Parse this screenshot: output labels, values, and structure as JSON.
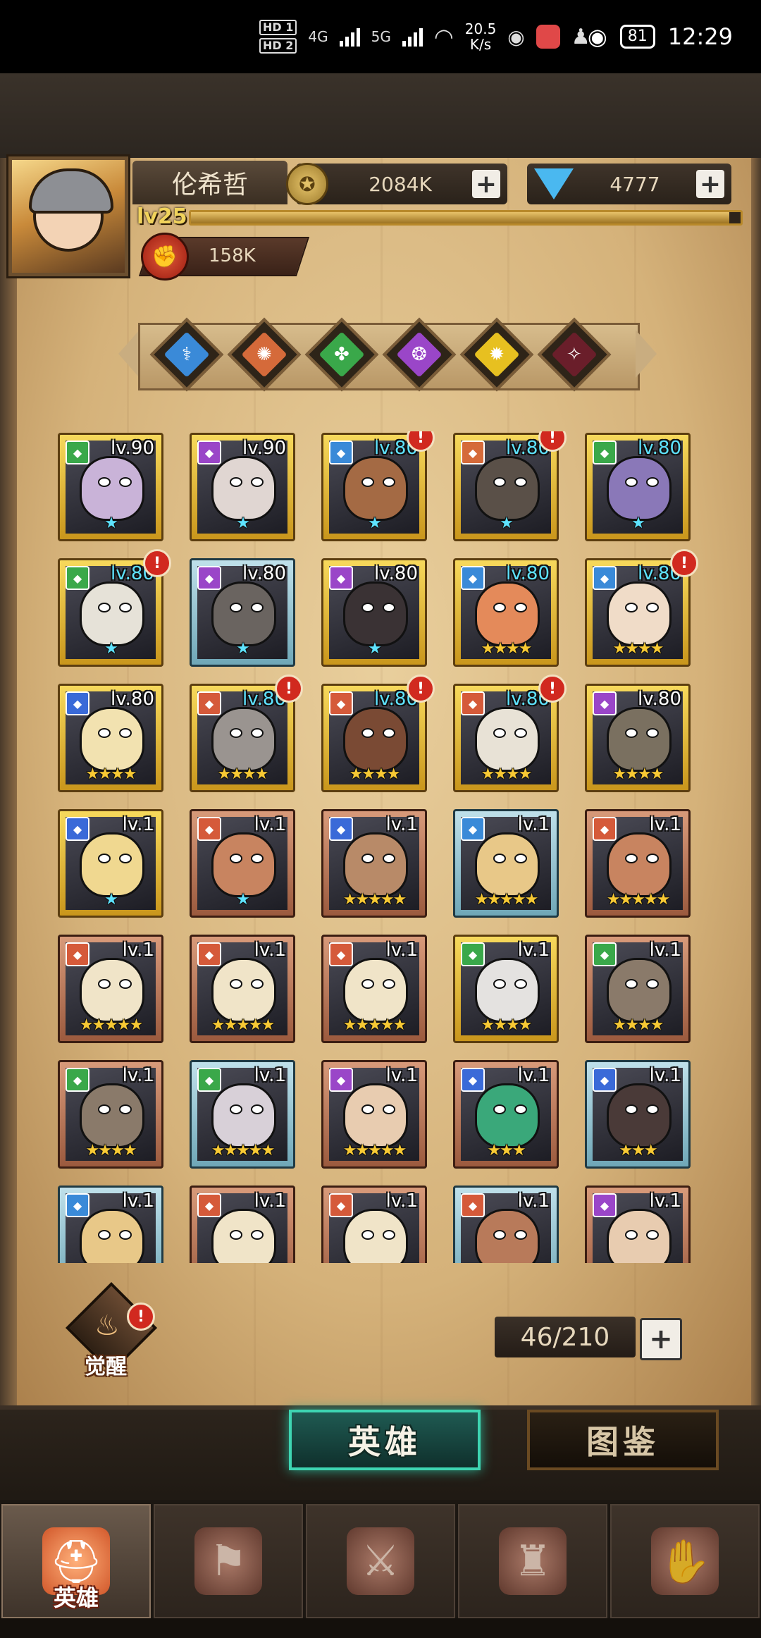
{
  "status_bar": {
    "hd1": "HD 1",
    "hd2": "HD 2",
    "net1": "4G",
    "net2": "5G",
    "speed_value": "20.5",
    "speed_unit": "K/s",
    "battery": "81",
    "time": "12:29",
    "icons": [
      "wechat-icon",
      "huawei-app-icon",
      "qq-icon",
      "eye-icon"
    ]
  },
  "player": {
    "name": "伦希哲",
    "level": "lv25",
    "gold": "2084K",
    "diamonds": "4777",
    "power": "158K",
    "xp_fraction": 0.98
  },
  "faction_filters": [
    {
      "name": "holy",
      "color": "#3a8ad8",
      "glyph": "⚕"
    },
    {
      "name": "fire",
      "color": "#d56a3a",
      "glyph": "✺"
    },
    {
      "name": "nature",
      "color": "#3aa84a",
      "glyph": "✤"
    },
    {
      "name": "arcane",
      "color": "#9a46c8",
      "glyph": "❂"
    },
    {
      "name": "light",
      "color": "#e7c020",
      "glyph": "✹"
    },
    {
      "name": "dark",
      "color": "#6a1e2a",
      "glyph": "✧"
    }
  ],
  "heroes": [
    {
      "frame": "gold",
      "tag": "#3aa84a",
      "level": "lv.90",
      "lvcolor": "white",
      "stars": "★",
      "starcolor": "blue",
      "alert": false,
      "skin": "#c9b3d8"
    },
    {
      "frame": "gold",
      "tag": "#9a46c8",
      "level": "lv.90",
      "lvcolor": "white",
      "stars": "★",
      "starcolor": "blue",
      "alert": false,
      "skin": "#e0d6d2"
    },
    {
      "frame": "gold",
      "tag": "#3a8ad8",
      "level": "lv.80",
      "lvcolor": "cyan",
      "stars": "★",
      "starcolor": "blue",
      "alert": true,
      "skin": "#a46a44"
    },
    {
      "frame": "gold",
      "tag": "#d56a3a",
      "level": "lv.80",
      "lvcolor": "cyan",
      "stars": "★",
      "starcolor": "blue",
      "alert": true,
      "skin": "#5a5048"
    },
    {
      "frame": "gold",
      "tag": "#3aa84a",
      "level": "lv.80",
      "lvcolor": "cyan",
      "stars": "★",
      "starcolor": "blue",
      "alert": false,
      "skin": "#8a78b8"
    },
    {
      "frame": "gold",
      "tag": "#3aa84a",
      "level": "lv.80",
      "lvcolor": "cyan",
      "stars": "★",
      "starcolor": "blue",
      "alert": true,
      "skin": "#e6e2d8"
    },
    {
      "frame": "silver",
      "tag": "#9a46c8",
      "level": "lv.80",
      "lvcolor": "white",
      "stars": "★",
      "starcolor": "blue",
      "alert": false,
      "skin": "#6a6460"
    },
    {
      "frame": "gold",
      "tag": "#9a46c8",
      "level": "lv.80",
      "lvcolor": "white",
      "stars": "★",
      "starcolor": "blue",
      "alert": false,
      "skin": "#3a3234"
    },
    {
      "frame": "gold",
      "tag": "#3a8ad8",
      "level": "lv.80",
      "lvcolor": "cyan",
      "stars": "★★★★",
      "starcolor": "gold",
      "alert": false,
      "skin": "#e48a5a"
    },
    {
      "frame": "gold",
      "tag": "#3a8ad8",
      "level": "lv.80",
      "lvcolor": "cyan",
      "stars": "★★★★",
      "starcolor": "gold",
      "alert": true,
      "skin": "#f0dcc8"
    },
    {
      "frame": "gold",
      "tag": "#3a6ad8",
      "level": "lv.80",
      "lvcolor": "white",
      "stars": "★★★★",
      "starcolor": "gold",
      "alert": false,
      "skin": "#f2e2b0"
    },
    {
      "frame": "gold",
      "tag": "#d55a3a",
      "level": "lv.80",
      "lvcolor": "cyan",
      "stars": "★★★★",
      "starcolor": "gold",
      "alert": true,
      "skin": "#9a9490"
    },
    {
      "frame": "gold",
      "tag": "#d55a3a",
      "level": "lv.80",
      "lvcolor": "cyan",
      "stars": "★★★★",
      "starcolor": "gold",
      "alert": true,
      "skin": "#7a4a34"
    },
    {
      "frame": "gold",
      "tag": "#d55a3a",
      "level": "lv.80",
      "lvcolor": "cyan",
      "stars": "★★★★",
      "starcolor": "gold",
      "alert": true,
      "skin": "#e8e2d6"
    },
    {
      "frame": "gold",
      "tag": "#9a46c8",
      "level": "lv.80",
      "lvcolor": "white",
      "stars": "★★★★",
      "starcolor": "gold",
      "alert": false,
      "skin": "#7a7060"
    },
    {
      "frame": "gold",
      "tag": "#3a6ad8",
      "level": "lv.1",
      "lvcolor": "white",
      "stars": "★",
      "starcolor": "blue",
      "alert": false,
      "skin": "#f0d890"
    },
    {
      "frame": "bronze",
      "tag": "#d55a3a",
      "level": "lv.1",
      "lvcolor": "white",
      "stars": "★",
      "starcolor": "blue",
      "alert": false,
      "skin": "#c88460"
    },
    {
      "frame": "bronze",
      "tag": "#3a6ad8",
      "level": "lv.1",
      "lvcolor": "white",
      "stars": "★★★★★",
      "starcolor": "gold",
      "alert": false,
      "skin": "#b88a68"
    },
    {
      "frame": "silver",
      "tag": "#3a8ad8",
      "level": "lv.1",
      "lvcolor": "white",
      "stars": "★★★★★",
      "starcolor": "gold",
      "alert": false,
      "skin": "#e8c888"
    },
    {
      "frame": "bronze",
      "tag": "#d55a3a",
      "level": "lv.1",
      "lvcolor": "white",
      "stars": "★★★★★",
      "starcolor": "gold",
      "alert": false,
      "skin": "#c88460"
    },
    {
      "frame": "bronze",
      "tag": "#d55a3a",
      "level": "lv.1",
      "lvcolor": "white",
      "stars": "★★★★★",
      "starcolor": "gold",
      "alert": false,
      "skin": "#f0e4c8"
    },
    {
      "frame": "bronze",
      "tag": "#d55a3a",
      "level": "lv.1",
      "lvcolor": "white",
      "stars": "★★★★★",
      "starcolor": "gold",
      "alert": false,
      "skin": "#f0e4c8"
    },
    {
      "frame": "bronze",
      "tag": "#d55a3a",
      "level": "lv.1",
      "lvcolor": "white",
      "stars": "★★★★★",
      "starcolor": "gold",
      "alert": false,
      "skin": "#f0e4c8"
    },
    {
      "frame": "gold",
      "tag": "#3aa84a",
      "level": "lv.1",
      "lvcolor": "white",
      "stars": "★★★★",
      "starcolor": "gold",
      "alert": false,
      "skin": "#e4e2e0"
    },
    {
      "frame": "bronze",
      "tag": "#3aa84a",
      "level": "lv.1",
      "lvcolor": "white",
      "stars": "★★★★",
      "starcolor": "gold",
      "alert": false,
      "skin": "#8a7a6a"
    },
    {
      "frame": "bronze",
      "tag": "#3aa84a",
      "level": "lv.1",
      "lvcolor": "white",
      "stars": "★★★★",
      "starcolor": "gold",
      "alert": false,
      "skin": "#8a7a6a"
    },
    {
      "frame": "silver",
      "tag": "#3aa84a",
      "level": "lv.1",
      "lvcolor": "white",
      "stars": "★★★★★",
      "starcolor": "gold",
      "alert": false,
      "skin": "#d8d0d8"
    },
    {
      "frame": "bronze",
      "tag": "#9a46c8",
      "level": "lv.1",
      "lvcolor": "white",
      "stars": "★★★★★",
      "starcolor": "gold",
      "alert": false,
      "skin": "#e8ccb0"
    },
    {
      "frame": "bronze",
      "tag": "#3a6ad8",
      "level": "lv.1",
      "lvcolor": "white",
      "stars": "★★★",
      "starcolor": "gold",
      "alert": false,
      "skin": "#3aa87a"
    },
    {
      "frame": "silver",
      "tag": "#3a6ad8",
      "level": "lv.1",
      "lvcolor": "white",
      "stars": "★★★",
      "starcolor": "gold",
      "alert": false,
      "skin": "#4a3a38"
    },
    {
      "frame": "silver",
      "tag": "#3a8ad8",
      "level": "lv.1",
      "lvcolor": "white",
      "stars": "",
      "starcolor": "gold",
      "alert": false,
      "skin": "#e8c888"
    },
    {
      "frame": "bronze",
      "tag": "#d55a3a",
      "level": "lv.1",
      "lvcolor": "white",
      "stars": "",
      "starcolor": "gold",
      "alert": false,
      "skin": "#f0e4c8"
    },
    {
      "frame": "bronze",
      "tag": "#d55a3a",
      "level": "lv.1",
      "lvcolor": "white",
      "stars": "",
      "starcolor": "gold",
      "alert": false,
      "skin": "#f0e4c8"
    },
    {
      "frame": "silver",
      "tag": "#d55a3a",
      "level": "lv.1",
      "lvcolor": "white",
      "stars": "",
      "starcolor": "gold",
      "alert": false,
      "skin": "#b87a5a"
    },
    {
      "frame": "bronze",
      "tag": "#9a46c8",
      "level": "lv.1",
      "lvcolor": "white",
      "stars": "",
      "starcolor": "gold",
      "alert": false,
      "skin": "#e8ccb0"
    }
  ],
  "awaken": {
    "label": "觉醒"
  },
  "hero_count": "46/210",
  "tabs": {
    "heroes": "英雄",
    "collection": "图鉴"
  },
  "bottom_nav": [
    {
      "label": "英雄",
      "icon": "hero-helmet-icon",
      "glyph": "⛑",
      "active": true
    },
    {
      "label": "",
      "icon": "adventure-flag-icon",
      "glyph": "⚑",
      "active": false
    },
    {
      "label": "",
      "icon": "battle-swords-icon",
      "glyph": "⚔",
      "active": false
    },
    {
      "label": "",
      "icon": "castle-icon",
      "glyph": "♜",
      "active": false
    },
    {
      "label": "",
      "icon": "guild-handshake-icon",
      "glyph": "✋",
      "active": false
    }
  ]
}
